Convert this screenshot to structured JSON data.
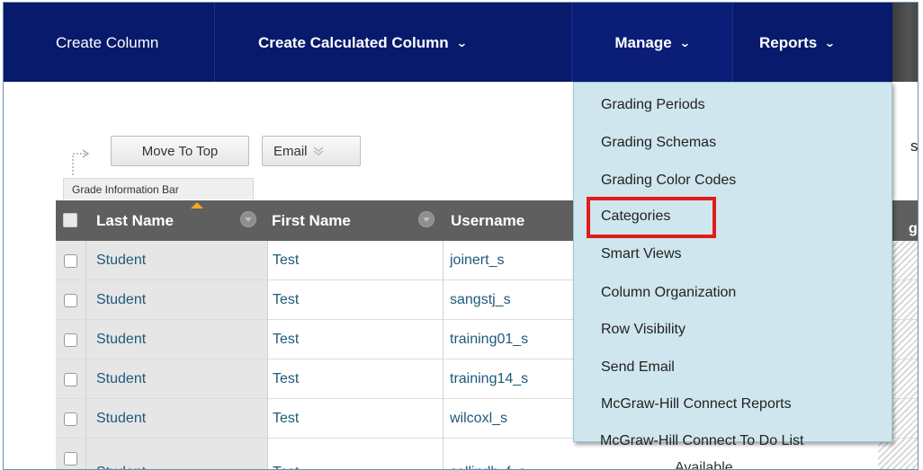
{
  "nav": {
    "create_column": "Create Column",
    "create_calculated_column": "Create Calculated Column",
    "manage": "Manage",
    "reports": "Reports",
    "chevron": "⌄"
  },
  "toolbar": {
    "move_to_top": "Move To Top",
    "email": "Email",
    "grade_information_bar": "Grade Information Bar",
    "clipped_right_text": "s"
  },
  "grid": {
    "headers": {
      "last_name": "Last Name",
      "first_name": "First Name",
      "username": "Username",
      "clipped_right_header": "gr"
    },
    "rows": [
      {
        "last": "Student",
        "first": "Test",
        "user": "joinert_s"
      },
      {
        "last": "Student",
        "first": "Test",
        "user": "sangstj_s"
      },
      {
        "last": "Student",
        "first": "Test",
        "user": "training01_s"
      },
      {
        "last": "Student",
        "first": "Test",
        "user": "training14_s"
      },
      {
        "last": "Student",
        "first": "Test",
        "user": "wilcoxl_s"
      },
      {
        "last": "Student",
        "first": "Test",
        "user": "collindb_f_s",
        "availability": "Available"
      }
    ]
  },
  "manage_menu": {
    "items": [
      "Grading Periods",
      "Grading Schemas",
      "Grading Color Codes",
      "Categories",
      "Smart Views",
      "Column Organization",
      "Row Visibility",
      "Send Email",
      "McGraw-Hill Connect Reports",
      "McGraw-Hill Connect To Do List"
    ],
    "highlighted_item": "Categories"
  },
  "colors": {
    "nav_bg": "#071a6b",
    "menu_bg": "#cfe6ee",
    "header_bg": "#5f5f5f",
    "highlight_border": "#e21b1b",
    "sort_indicator": "#f5a623"
  }
}
